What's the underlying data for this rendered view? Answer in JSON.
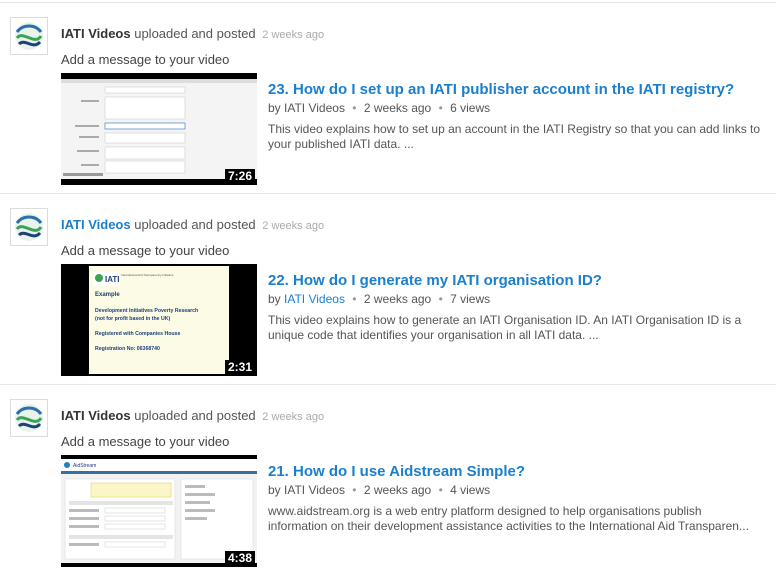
{
  "feed": {
    "items": [
      {
        "author": "IATI Videos",
        "author_linked": false,
        "verb": "uploaded and posted",
        "time": "2 weeks ago",
        "message_placeholder": "Add a message to your video",
        "duration": "7:26",
        "title": "23. How do I set up an IATI publisher account in the IATI registry?",
        "by_prefix": "by",
        "by_author": "IATI Videos",
        "by_linked": false,
        "age": "2 weeks ago",
        "views": "6 views",
        "desc_lines": [
          "This video explains how to set up an account in the IATI Registry so that you can add links to",
          "your published IATI data. ..."
        ]
      },
      {
        "author": "IATI Videos",
        "author_linked": true,
        "verb": "uploaded and posted",
        "time": "2 weeks ago",
        "message_placeholder": "Add a message to your video",
        "duration": "2:31",
        "title": "22. How do I generate my IATI organisation ID?",
        "by_prefix": "by",
        "by_author": "IATI Videos",
        "by_linked": true,
        "age": "2 weeks ago",
        "views": "7 views",
        "desc_lines": [
          "This video explains how to generate an IATI Organisation ID. An IATI Organisation ID is a",
          "unique code that identifies your organisation in all IATI data. ..."
        ],
        "thumb_text": {
          "logo": "IATI",
          "logo_sub": "International Aid Transparency Initiative",
          "heading": "Example",
          "org_line1": "Development Initiatives Poverty Research",
          "org_line2": "(not for profit based in the UK)",
          "registered": "Registered with Companies House",
          "reg_no": "Registration No: 06368740"
        }
      },
      {
        "author": "IATI Videos",
        "author_linked": false,
        "verb": "uploaded and posted",
        "time": "2 weeks ago",
        "message_placeholder": "Add a message to your video",
        "duration": "4:38",
        "title": "21. How do I use Aidstream Simple?",
        "by_prefix": "by",
        "by_author": "IATI Videos",
        "by_linked": false,
        "age": "2 weeks ago",
        "views": "4 views",
        "desc_lines": [
          "www.aidstream.org is a web entry platform designed to help organisations publish",
          "information on their development assistance activities to the International Aid Transparen..."
        ],
        "thumb_text": {
          "brand": "AidStream"
        }
      }
    ]
  },
  "colors": {
    "link": "#1b7fcc",
    "separator": "#e8e8e8",
    "muted": "#aaaaaa"
  }
}
